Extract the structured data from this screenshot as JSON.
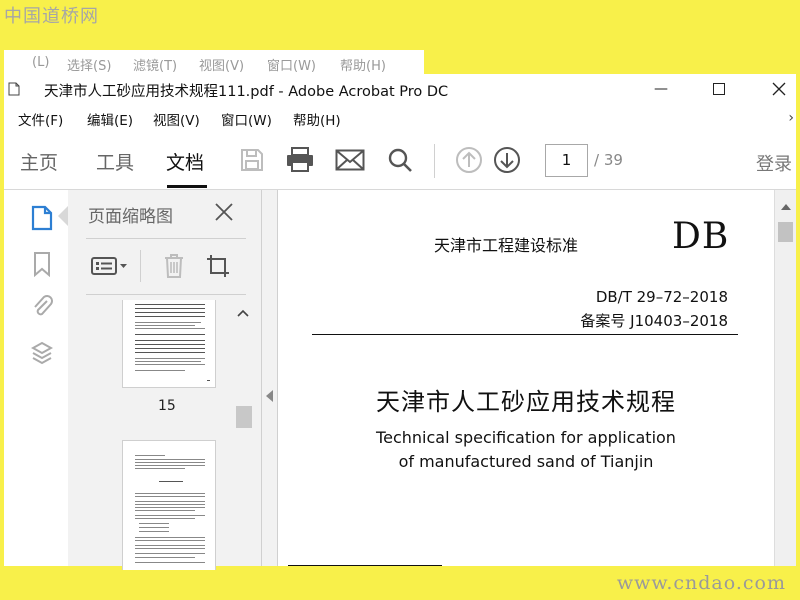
{
  "watermark": {
    "top": "中国道桥网",
    "bottom": "www.cndao.com"
  },
  "background_menu": [
    "(L)",
    "选择(S)",
    "滤镜(T)",
    "视图(V)",
    "窗口(W)",
    "帮助(H)"
  ],
  "window": {
    "title": "天津市人工砂应用技术规程111.pdf - Adobe Acrobat Pro DC",
    "minimize_symbol": "—",
    "maximize_symbol": "☐",
    "close_symbol": "✕"
  },
  "menu": [
    "文件(F)",
    "编辑(E)",
    "视图(V)",
    "窗口(W)",
    "帮助(H)"
  ],
  "toolbar": {
    "tabs": [
      {
        "label": "主页",
        "active": false
      },
      {
        "label": "工具",
        "active": false
      },
      {
        "label": "文档",
        "active": true
      }
    ],
    "icons": [
      "save-icon",
      "print-icon",
      "email-icon",
      "search-icon",
      "prev-page-icon",
      "next-page-icon"
    ],
    "page_current": "1",
    "page_total": "/ 39",
    "login_label": "登录"
  },
  "left_rail_icons": [
    "page-thumbnails-icon",
    "bookmark-icon",
    "attachment-icon",
    "layers-icon"
  ],
  "thumbnail_panel": {
    "title": "页面缩略图",
    "tools": [
      "options-menu-icon",
      "delete-icon",
      "crop-icon"
    ],
    "pages": [
      {
        "label": "15"
      },
      {
        "label": ""
      }
    ]
  },
  "document": {
    "standard_label": "天津市工程建设标准",
    "db_mark": "DB",
    "code": "DB/T 29–72–2018",
    "record": "备案号 J10403–2018",
    "title_cn": "天津市人工砂应用技术规程",
    "title_en_line1": "Technical specification for application",
    "title_en_line2": "of manufactured sand of  Tianjin"
  },
  "colors": {
    "frame": "#ffff00",
    "panel_bg": "#f2f2f2",
    "text": "#111111",
    "muted": "#666666"
  }
}
